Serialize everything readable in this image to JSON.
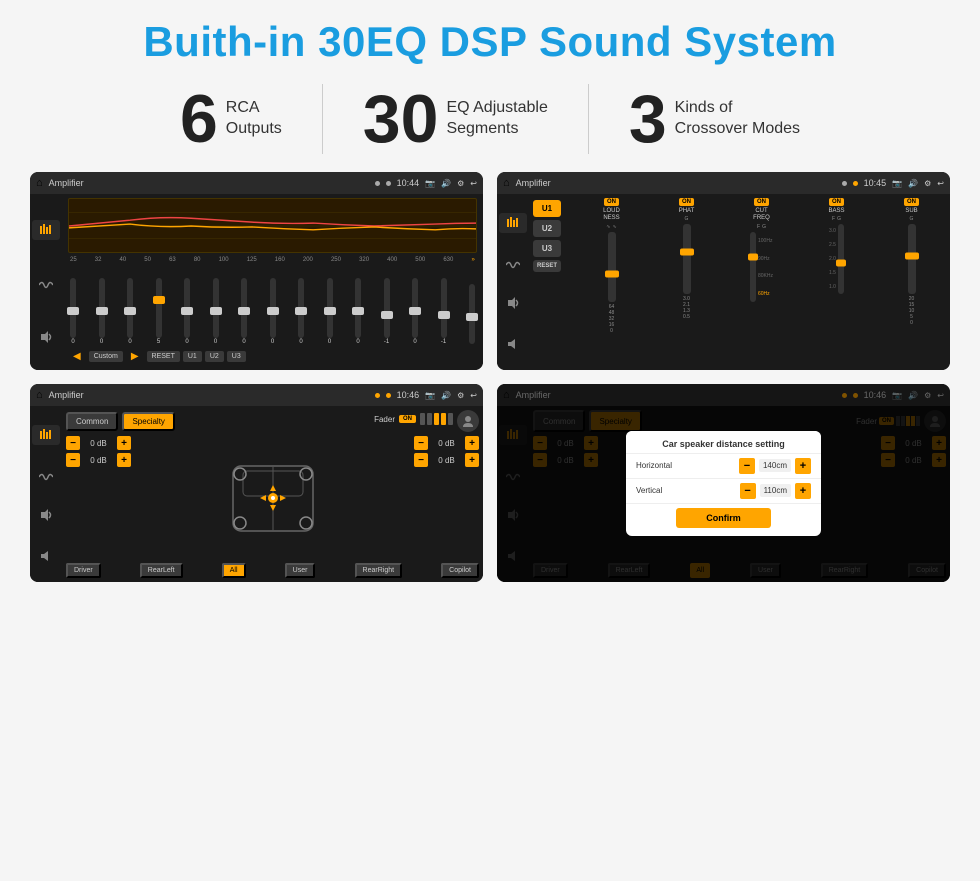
{
  "title": "Buith-in 30EQ DSP Sound System",
  "stats": [
    {
      "number": "6",
      "text_line1": "RCA",
      "text_line2": "Outputs"
    },
    {
      "number": "30",
      "text_line1": "EQ Adjustable",
      "text_line2": "Segments"
    },
    {
      "number": "3",
      "text_line1": "Kinds of",
      "text_line2": "Crossover Modes"
    }
  ],
  "screens": {
    "eq": {
      "title": "Amplifier",
      "time": "10:44",
      "freqs": [
        "25",
        "32",
        "40",
        "50",
        "63",
        "80",
        "100",
        "125",
        "160",
        "200",
        "250",
        "320",
        "400",
        "500",
        "630"
      ],
      "values": [
        "0",
        "0",
        "0",
        "5",
        "0",
        "0",
        "0",
        "0",
        "0",
        "0",
        "0",
        "-1",
        "0",
        "-1",
        ""
      ],
      "buttons": [
        "Custom",
        "RESET",
        "U1",
        "U2",
        "U3"
      ]
    },
    "crossover": {
      "title": "Amplifier",
      "time": "10:45",
      "presets": [
        "U1",
        "U2",
        "U3"
      ],
      "channels": [
        "LOUDNESS",
        "PHAT",
        "CUT FREQ",
        "BASS",
        "SUB"
      ]
    },
    "speaker": {
      "title": "Amplifier",
      "time": "10:46",
      "tabs": [
        "Common",
        "Specialty"
      ],
      "fader_label": "Fader",
      "fader_on": "ON",
      "buttons": [
        "Driver",
        "Copilot",
        "RearLeft",
        "All",
        "User",
        "RearRight"
      ],
      "vol_values": [
        "0 dB",
        "0 dB",
        "0 dB",
        "0 dB"
      ]
    },
    "distance": {
      "title": "Amplifier",
      "time": "10:46",
      "tabs": [
        "Common",
        "Specialty"
      ],
      "dialog": {
        "title": "Car speaker distance setting",
        "horizontal_label": "Horizontal",
        "horizontal_value": "140cm",
        "vertical_label": "Vertical",
        "vertical_value": "110cm",
        "confirm_label": "Confirm"
      },
      "buttons": [
        "Driver",
        "Copilot",
        "RearLeft",
        "All",
        "User",
        "RearRight"
      ],
      "vol_values": [
        "0 dB",
        "0 dB"
      ]
    }
  }
}
